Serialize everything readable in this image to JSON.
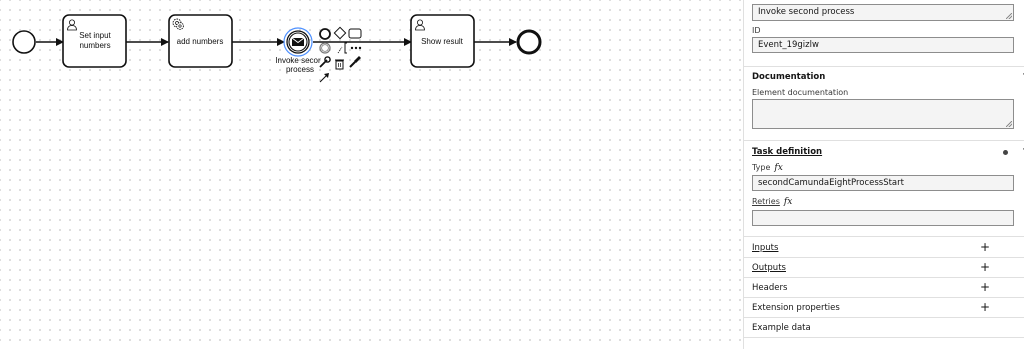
{
  "diagram": {
    "tasks": [
      {
        "label_lines": [
          "Set input",
          "numbers"
        ],
        "icon": "user-task-icon"
      },
      {
        "label_lines": [
          "add numbers"
        ],
        "icon": "service-task-icon"
      },
      {
        "label_lines": [
          "Show result"
        ],
        "icon": "user-task-icon"
      }
    ],
    "selected_event_label_lines": [
      "Invoke secor",
      "process"
    ]
  },
  "panel": {
    "name_value": "Invoke second process",
    "id_label": "ID",
    "id_value": "Event_19gizlw",
    "documentation": {
      "title": "Documentation",
      "element_label": "Element documentation",
      "element_value": ""
    },
    "task_definition": {
      "title": "Task definition",
      "type_label": "Type",
      "type_value": "secondCamundaEightProcessStart",
      "retries_label": "Retries",
      "retries_value": "",
      "fx": "fx"
    },
    "groups": [
      {
        "title": "Inputs",
        "action": "+"
      },
      {
        "title": "Outputs",
        "action": "+"
      },
      {
        "title": "Headers",
        "action": "+"
      },
      {
        "title": "Extension properties",
        "action": "+"
      },
      {
        "title": "Example data",
        "action": ""
      }
    ]
  }
}
